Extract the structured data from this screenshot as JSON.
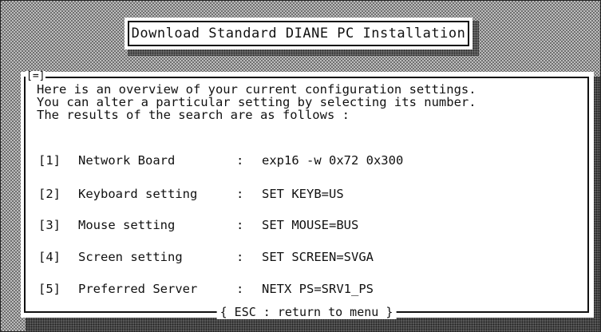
{
  "title": "Download Standard DIANE PC Installation",
  "dialog": {
    "close_box": "[=]",
    "intro_lines": [
      "Here is an overview of your current configuration settings.",
      "You can alter a particular setting by selecting its number.",
      "The results of the search are as follows :"
    ],
    "settings": [
      {
        "number": "[1]",
        "name": "Network Board",
        "colon": ":",
        "value": "exp16 -w 0x72 0x300"
      },
      {
        "number": "[2]",
        "name": "Keyboard setting",
        "colon": ":",
        "value": "SET KEYB=US"
      },
      {
        "number": "[3]",
        "name": "Mouse setting",
        "colon": ":",
        "value": "SET MOUSE=BUS"
      },
      {
        "number": "[4]",
        "name": "Screen setting",
        "colon": ":",
        "value": "SET SCREEN=SVGA"
      },
      {
        "number": "[5]",
        "name": "Preferred Server",
        "colon": ":",
        "value": "NETX PS=SRV1_PS"
      }
    ],
    "footer": "{ ESC : return to menu }"
  }
}
